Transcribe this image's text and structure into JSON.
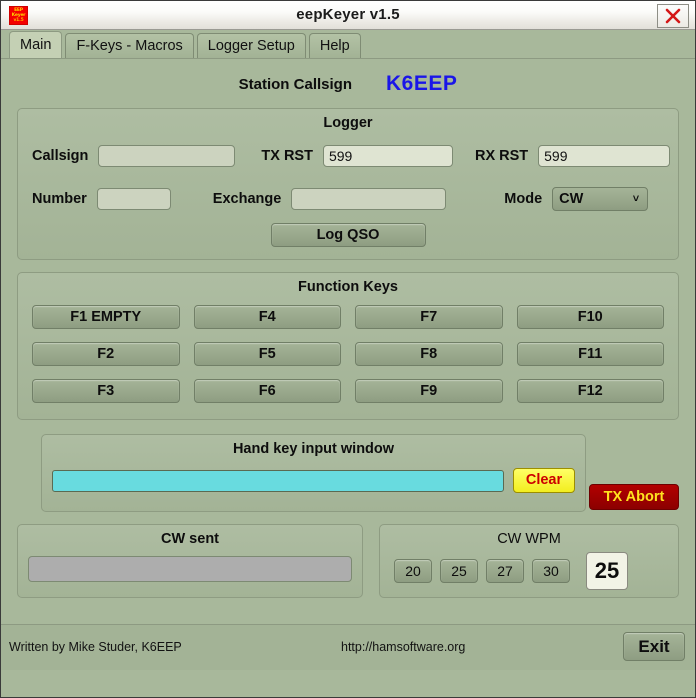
{
  "window": {
    "title": "eepKeyer v1.5",
    "icon_lines": [
      "EEP",
      "Keyer",
      "v1.5"
    ],
    "close_icon": "close-x-icon"
  },
  "tabs": [
    {
      "label": "Main",
      "active": true
    },
    {
      "label": "F-Keys - Macros",
      "active": false
    },
    {
      "label": "Logger Setup",
      "active": false
    },
    {
      "label": "Help",
      "active": false
    }
  ],
  "station": {
    "label": "Station Callsign",
    "callsign": "K6EEP",
    "callsign_color": "#1a15e8"
  },
  "logger": {
    "title": "Logger",
    "callsign_label": "Callsign",
    "callsign_value": "",
    "tx_rst_label": "TX RST",
    "tx_rst_value": "599",
    "rx_rst_label": "RX RST",
    "rx_rst_value": "599",
    "number_label": "Number",
    "number_value": "",
    "exchange_label": "Exchange",
    "exchange_value": "",
    "mode_label": "Mode",
    "mode_value": "CW",
    "mode_chevron": "chevron-down-icon",
    "log_qso_label": "Log QSO"
  },
  "function_keys": {
    "title": "Function Keys",
    "keys": [
      "F1 EMPTY",
      "F4",
      "F7",
      "F10",
      "F2",
      "F5",
      "F8",
      "F11",
      "F3",
      "F6",
      "F9",
      "F12"
    ]
  },
  "hand_key": {
    "title": "Hand key input window",
    "input_value": "",
    "input_color": "#68dbdf",
    "clear_label": "Clear",
    "clear_bg": "#f7f320",
    "clear_fg": "#cc0000"
  },
  "tx_abort": {
    "label": "TX Abort",
    "bg": "#9e0000",
    "fg": "#ffe21f"
  },
  "cw_sent": {
    "title": "CW sent",
    "value": "",
    "field_color": "#adadad"
  },
  "cw_wpm": {
    "title": "CW WPM",
    "presets": [
      "20",
      "25",
      "27",
      "30"
    ],
    "current": "25"
  },
  "footer": {
    "credit": "Written by Mike Studer, K6EEP",
    "url": "http://hamsoftware.org",
    "exit_label": "Exit"
  }
}
